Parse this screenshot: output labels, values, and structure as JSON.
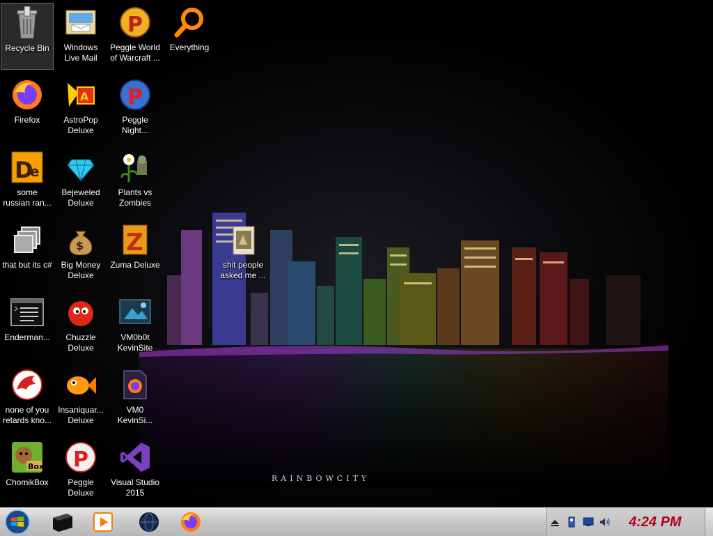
{
  "wallpaper": {
    "caption": "RAINBOWCITY"
  },
  "desktop_icons": [
    {
      "label": "Recycle Bin",
      "icon": "recycle-bin-icon"
    },
    {
      "label": "Windows\nLive Mail",
      "icon": "mail-icon"
    },
    {
      "label": "Peggle World\nof Warcraft ...",
      "icon": "peggle-icon"
    },
    {
      "label": "Everything",
      "icon": "magnifier-icon"
    },
    {
      "label": "Firefox",
      "icon": "firefox-icon"
    },
    {
      "label": "AstroPop\nDeluxe",
      "icon": "astropop-icon"
    },
    {
      "label": "Peggle\nNight...",
      "icon": "peggle-night-icon"
    },
    {
      "label": "some\nrussian ran...",
      "icon": "de-icon"
    },
    {
      "label": "Bejeweled\nDeluxe",
      "icon": "gem-icon"
    },
    {
      "label": "Plants vs\nZombies",
      "icon": "flower-icon"
    },
    {
      "label": "that but its c#",
      "icon": "window-stack-icon"
    },
    {
      "label": "Big Money\nDeluxe",
      "icon": "money-bag-icon"
    },
    {
      "label": "Zuma Deluxe",
      "icon": "zuma-icon"
    },
    {
      "label": "shit people\nasked me ...",
      "icon": "folder-icon"
    },
    {
      "label": "Enderman...",
      "icon": "console-icon"
    },
    {
      "label": "Chuzzle\nDeluxe",
      "icon": "chuzzle-icon"
    },
    {
      "label": "VM0b0t\nKevinSite",
      "icon": "vm-screen-icon"
    },
    {
      "label": "none of you\nretards kno...",
      "icon": "dragon-icon"
    },
    {
      "label": "Insaniquar...\nDeluxe",
      "icon": "goldfish-icon"
    },
    {
      "label": "VM0\nKevinSi...",
      "icon": "firefox-file-icon"
    },
    {
      "label": "ChomikBox",
      "icon": "chomikbox-icon"
    },
    {
      "label": "Peggle\nDeluxe",
      "icon": "peggle-deluxe-icon"
    },
    {
      "label": "Visual Studio\n2015",
      "icon": "visual-studio-icon"
    }
  ],
  "taskbar": {
    "pinned": [
      "explorer-icon",
      "media-player-icon",
      "globe-icon",
      "firefox-icon"
    ],
    "tray_icons": [
      "show-hidden-icon",
      "usb-icon",
      "network-icon",
      "volume-icon"
    ],
    "clock": "4:24 PM"
  },
  "colors": {
    "clock": "#b3001b",
    "taskbar": "#c9c9c9"
  }
}
